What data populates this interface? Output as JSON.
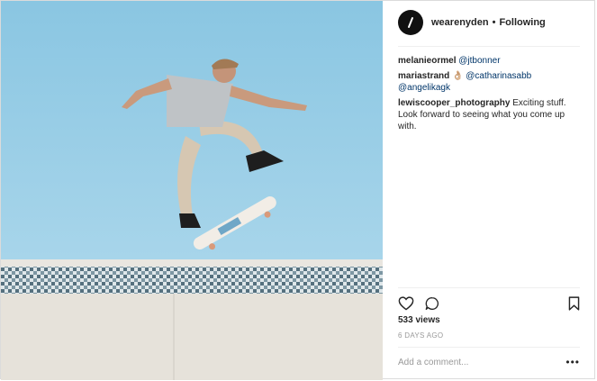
{
  "post": {
    "username": "wearenyden",
    "separator": "•",
    "follow_status": "Following",
    "comments": [
      {
        "user": "melanieormel",
        "mention": "@jtbonner"
      },
      {
        "user": "mariastrand",
        "emoji": "👌🏼",
        "mention": "@catharinasabb",
        "mention2": "@angelikagk"
      },
      {
        "user": "lewiscooper_photography",
        "text": "Exciting stuff. Look forward to seeing what you come up with."
      }
    ],
    "views": "533 views",
    "date": "6 DAYS AGO",
    "add_comment_placeholder": "Add a comment...",
    "more_options": "•••"
  },
  "icons": {
    "like": "heart-icon",
    "comment": "comment-icon",
    "save": "bookmark-icon",
    "avatar": "slash-logo-icon"
  },
  "colors": {
    "sky": "#8ec9e4",
    "mention": "#003569",
    "muted": "#999999"
  }
}
